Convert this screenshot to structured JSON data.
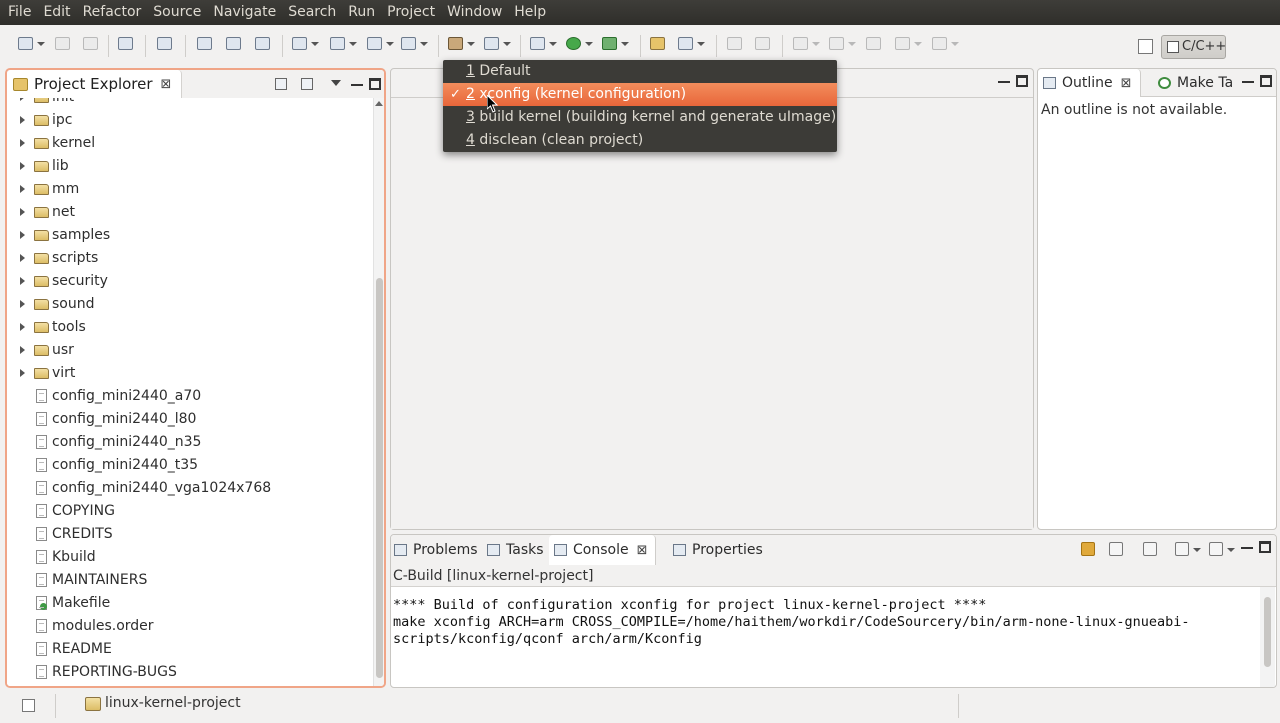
{
  "menubar": [
    "File",
    "Edit",
    "Refactor",
    "Source",
    "Navigate",
    "Search",
    "Run",
    "Project",
    "Window",
    "Help"
  ],
  "perspective": {
    "label": "C/C++"
  },
  "project_explorer": {
    "title": "Project Explorer",
    "close": "⊠",
    "items": [
      {
        "label": "init",
        "type": "folder"
      },
      {
        "label": "ipc",
        "type": "folder"
      },
      {
        "label": "kernel",
        "type": "folder"
      },
      {
        "label": "lib",
        "type": "folder"
      },
      {
        "label": "mm",
        "type": "folder"
      },
      {
        "label": "net",
        "type": "folder"
      },
      {
        "label": "samples",
        "type": "folder"
      },
      {
        "label": "scripts",
        "type": "folder"
      },
      {
        "label": "security",
        "type": "folder"
      },
      {
        "label": "sound",
        "type": "folder"
      },
      {
        "label": "tools",
        "type": "folder"
      },
      {
        "label": "usr",
        "type": "folder"
      },
      {
        "label": "virt",
        "type": "folder"
      },
      {
        "label": "config_mini2440_a70",
        "type": "file"
      },
      {
        "label": "config_mini2440_l80",
        "type": "file"
      },
      {
        "label": "config_mini2440_n35",
        "type": "file"
      },
      {
        "label": "config_mini2440_t35",
        "type": "file"
      },
      {
        "label": "config_mini2440_vga1024x768",
        "type": "file"
      },
      {
        "label": "COPYING",
        "type": "file"
      },
      {
        "label": "CREDITS",
        "type": "file"
      },
      {
        "label": "Kbuild",
        "type": "file"
      },
      {
        "label": "MAINTAINERS",
        "type": "file"
      },
      {
        "label": "Makefile",
        "type": "makefile"
      },
      {
        "label": "modules.order",
        "type": "file"
      },
      {
        "label": "README",
        "type": "file"
      },
      {
        "label": "REPORTING-BUGS",
        "type": "file"
      }
    ]
  },
  "outline": {
    "tabs": [
      {
        "label": "Outline",
        "close": "⊠"
      },
      {
        "label": "Make Ta"
      }
    ],
    "message": "An outline is not available."
  },
  "console": {
    "tabs": [
      {
        "label": "Problems"
      },
      {
        "label": "Tasks"
      },
      {
        "label": "Console",
        "close": "⊠"
      },
      {
        "label": "Properties"
      }
    ],
    "subtitle": "C-Build [linux-kernel-project]",
    "lines": [
      "**** Build of configuration xconfig for project linux-kernel-project ****",
      "",
      "make xconfig ARCH=arm CROSS_COMPILE=/home/haithem/workdir/CodeSourcery/bin/arm-none-linux-gnueabi-",
      "scripts/kconfig/qconf arch/arm/Kconfig"
    ]
  },
  "build_menu": {
    "items": [
      {
        "num": "1",
        "label": "Default"
      },
      {
        "num": "2",
        "label": "xconfig (kernel configuration)",
        "checked": "✓"
      },
      {
        "num": "3",
        "label": "build kernel (building kernel and generate uImage)"
      },
      {
        "num": "4",
        "label": "disclean (clean project)"
      }
    ]
  },
  "statusbar": {
    "project": "linux-kernel-project"
  },
  "colors": {
    "accent": "#f07746",
    "menubar": "#3c3b37",
    "selection": "#ec7444"
  }
}
